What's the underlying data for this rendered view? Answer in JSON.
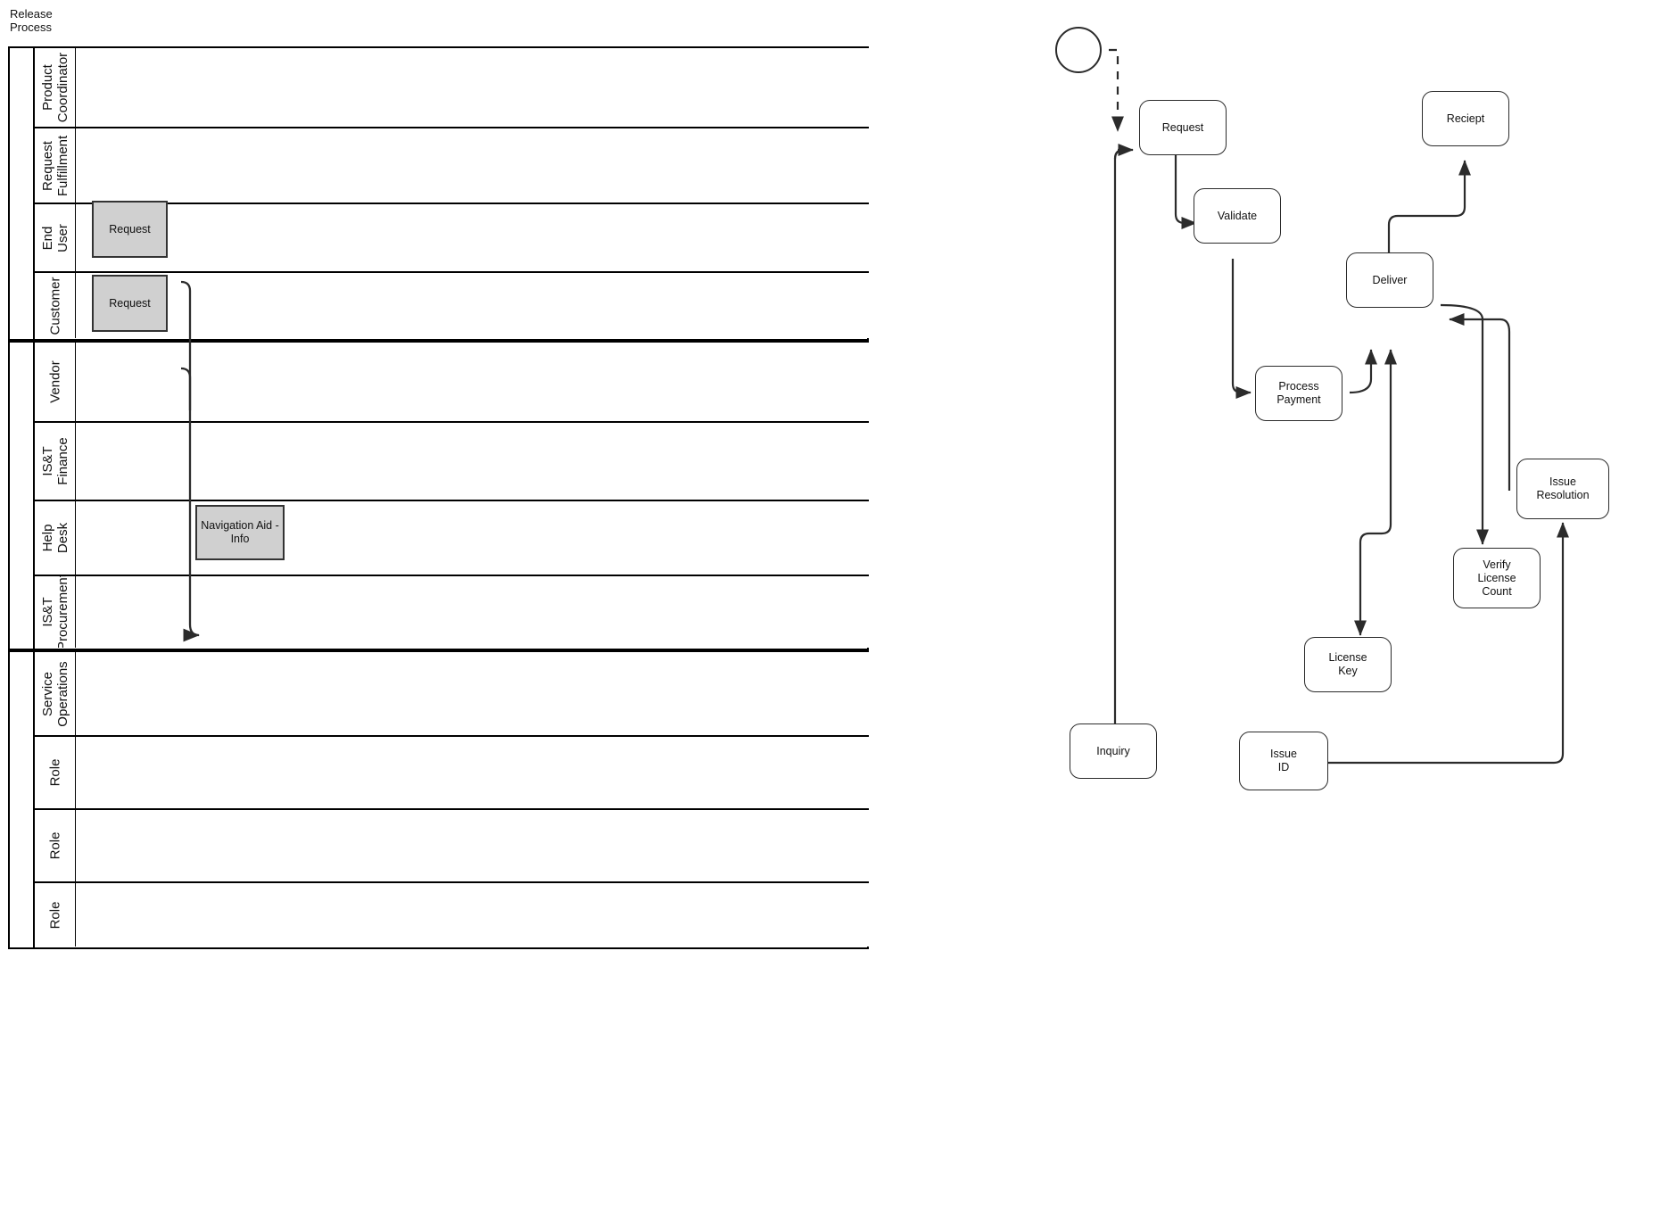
{
  "title": "Release\nProcess",
  "pools": [
    {
      "name": "pool-top",
      "lanes": [
        {
          "label": "Product\nCoordinator",
          "tasks": []
        },
        {
          "label": "Request\nFulfillment",
          "tasks": []
        },
        {
          "label": "End User",
          "tasks": [
            {
              "label": "Request"
            }
          ]
        },
        {
          "label": "Customer",
          "tasks": [
            {
              "label": "Request"
            }
          ]
        }
      ]
    },
    {
      "name": "pool-middle",
      "lanes": [
        {
          "label": "Vendor",
          "tasks": []
        },
        {
          "label": "IS&T\nFinance",
          "tasks": []
        },
        {
          "label": "Help Desk",
          "tasks": [
            {
              "label": "Navigation Aid -\nInfo"
            }
          ]
        },
        {
          "label": "IS&T\nProcurement",
          "tasks": []
        }
      ]
    },
    {
      "name": "pool-bottom",
      "lanes": [
        {
          "label": "Service\nOperations",
          "tasks": []
        },
        {
          "label": "Role",
          "tasks": []
        },
        {
          "label": "Role",
          "tasks": []
        },
        {
          "label": "Role",
          "tasks": []
        }
      ]
    }
  ],
  "flowchart": {
    "start_event": {
      "name": "start-event"
    },
    "nodes": [
      {
        "id": "request",
        "label": "Request"
      },
      {
        "id": "validate",
        "label": "Validate"
      },
      {
        "id": "reciept",
        "label": "Reciept"
      },
      {
        "id": "deliver",
        "label": "Deliver"
      },
      {
        "id": "process-payment",
        "label": "Process\nPayment"
      },
      {
        "id": "issue-resolution",
        "label": "Issue\nResolution"
      },
      {
        "id": "verify-license-count",
        "label": "Verify\nLicense\nCount"
      },
      {
        "id": "license-key",
        "label": "License\nKey"
      },
      {
        "id": "inquiry",
        "label": "Inquiry"
      },
      {
        "id": "issue-id",
        "label": "Issue\nID"
      }
    ]
  },
  "colors": {
    "stroke": "#2b2b2b",
    "lane_border": "#000000",
    "task_fill": "#d0d0d0",
    "task_border": "#333333",
    "background": "#ffffff"
  }
}
